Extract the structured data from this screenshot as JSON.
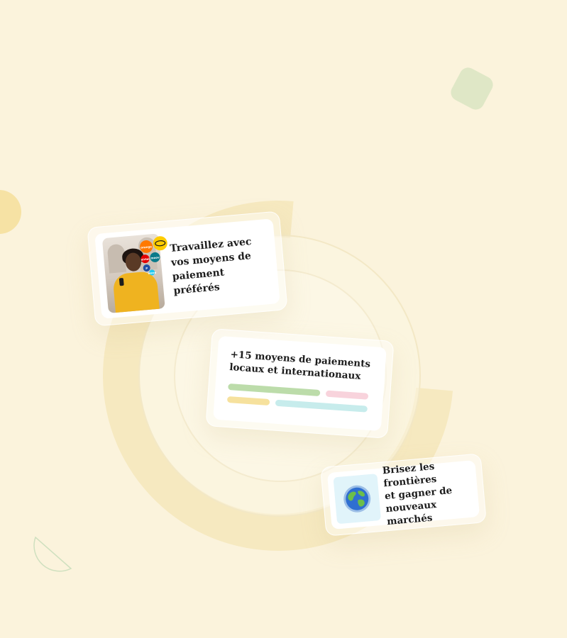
{
  "card_payment_methods": {
    "lines": [
      "Travaillez avec",
      "vos moyens de",
      "paiement préférés"
    ],
    "logos": [
      {
        "name": "orange-logo",
        "label": "orange",
        "color": "#ff7900"
      },
      {
        "name": "mtn-logo",
        "label": "MTN",
        "color": "#ffcc00"
      },
      {
        "name": "moov-logo",
        "label": "moov",
        "color": "#0a7a8a"
      },
      {
        "name": "wave-logo",
        "label": "wave",
        "color": "#1ec8f0"
      },
      {
        "name": "airtel-logo",
        "label": "airtel",
        "color": "#e40000"
      },
      {
        "name": "paypal-logo",
        "label": "P",
        "color": "#1f4fa3"
      }
    ]
  },
  "card_methods_count": {
    "lines": [
      "+15 moyens de paiements",
      "locaux et internationaux"
    ],
    "bar_colors": [
      "#bcdcaa",
      "#f8d3dc",
      "#f6e19d",
      "#c7ecec"
    ]
  },
  "card_markets": {
    "lines": [
      "Brisez les frontières",
      "et gagner de",
      "nouveaux marchés"
    ],
    "icon": "globe-icon"
  },
  "colors": {
    "background": "#fbf3dc",
    "ring": "#f6e8bd",
    "accent_green": "#dfe7c6",
    "accent_yellow": "#f6e2a4"
  }
}
